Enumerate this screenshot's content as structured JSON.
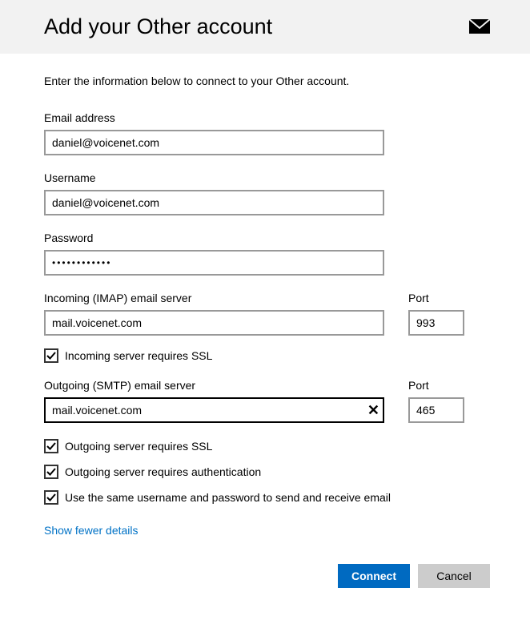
{
  "header": {
    "title": "Add your Other account"
  },
  "intro": "Enter the information below to connect to your Other account.",
  "fields": {
    "email": {
      "label": "Email address",
      "value": "daniel@voicenet.com"
    },
    "username": {
      "label": "Username",
      "value": "daniel@voicenet.com"
    },
    "password": {
      "label": "Password",
      "value": "••••••••••••"
    },
    "imap": {
      "label": "Incoming (IMAP) email server",
      "value": "mail.voicenet.com"
    },
    "imap_port": {
      "label": "Port",
      "value": "993"
    },
    "smtp": {
      "label": "Outgoing (SMTP) email server",
      "value": "mail.voicenet.com"
    },
    "smtp_port": {
      "label": "Port",
      "value": "465"
    }
  },
  "checkboxes": {
    "incoming_ssl": "Incoming server requires SSL",
    "outgoing_ssl": "Outgoing server requires SSL",
    "outgoing_auth": "Outgoing server requires authentication",
    "same_creds": "Use the same username and password to send and receive email"
  },
  "link": "Show fewer details",
  "buttons": {
    "connect": "Connect",
    "cancel": "Cancel"
  }
}
